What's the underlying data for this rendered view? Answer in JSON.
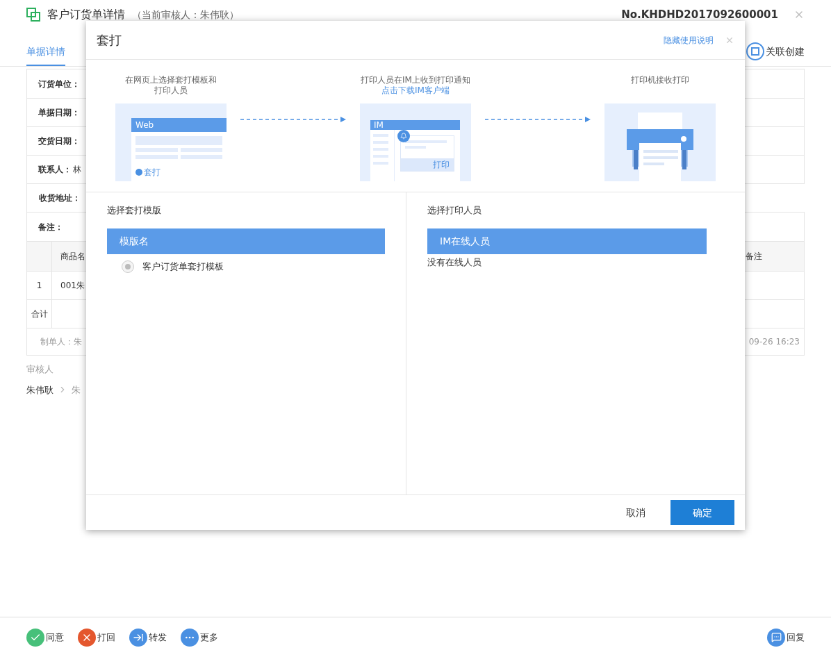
{
  "page": {
    "title": "客户订货单详情",
    "subtitle": "（当前审核人：朱伟耿）",
    "doc_no": "No.KHDHD2017092600001",
    "tabs": [
      {
        "label": "单据详情",
        "selected": true
      }
    ],
    "related_button": "关联创建",
    "form_rows": [
      {
        "label": "订货单位："
      },
      {
        "label": "单据日期："
      },
      {
        "label": "交货日期："
      },
      {
        "label": "联系人：",
        "value": "林"
      }
    ],
    "address_label": "收货地址：",
    "note_label": "备注：",
    "goods_table": {
      "columns": [
        "",
        "商品名",
        "备注"
      ],
      "rows": [
        [
          "1",
          "001朱"
        ]
      ],
      "total_label": "合计",
      "footer_left": "制单人：朱",
      "footer_right": "09-26 16:23"
    },
    "approval": {
      "label": "审核人",
      "chain": [
        "朱伟耿",
        "朱"
      ]
    },
    "actions": [
      {
        "label": "同意",
        "kind": "agree"
      },
      {
        "label": "打回",
        "kind": "reject"
      },
      {
        "label": "转发",
        "kind": "forward"
      },
      {
        "label": "更多",
        "kind": "more"
      }
    ],
    "reply": "回复"
  },
  "dialog": {
    "title": "套打",
    "help_link": "隐藏使用说明",
    "steps": [
      {
        "kind": "web",
        "caption": [
          "在网页上选择套打模板和",
          "打印人员"
        ],
        "window_title": "Web",
        "action": "套打"
      },
      {
        "kind": "im",
        "caption": [
          "打印人员在IM上收到打印通知"
        ],
        "link": "点击下载IM客户端",
        "window_title": "IM",
        "action": "打印"
      },
      {
        "kind": "printer",
        "caption": [
          "打印机接收打印"
        ]
      }
    ],
    "template_panel": {
      "heading": "选择套打模版",
      "column": "模版名",
      "items": [
        {
          "label": "客户订货单套打模板",
          "selected": true
        }
      ]
    },
    "printer_panel": {
      "heading": "选择打印人员",
      "column": "IM在线人员",
      "empty_text": "没有在线人员"
    },
    "buttons": [
      {
        "label": "取消",
        "kind": "secondary"
      },
      {
        "label": "确定",
        "kind": "primary"
      }
    ]
  }
}
